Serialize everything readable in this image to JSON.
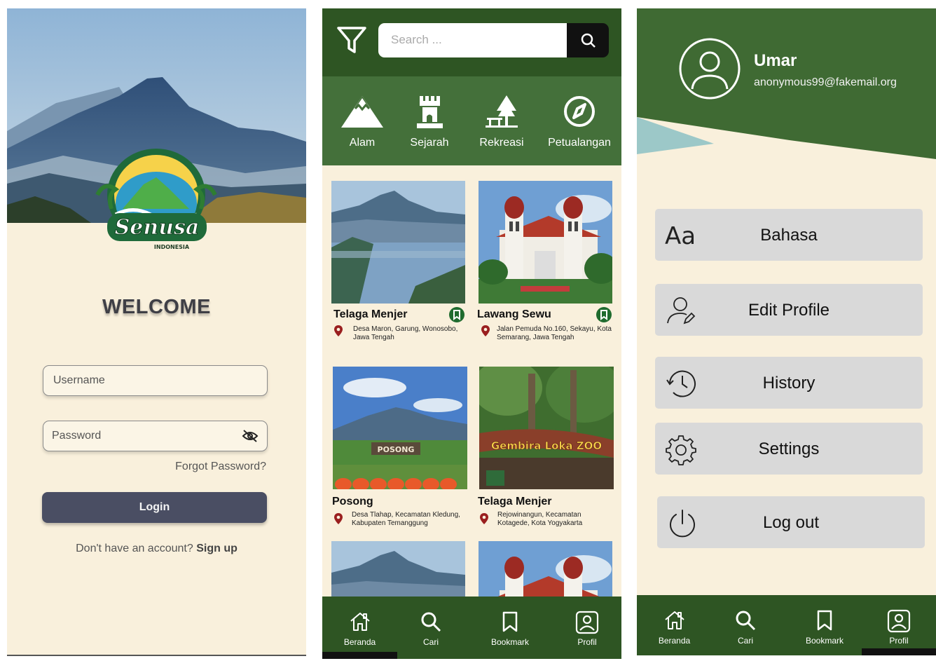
{
  "login": {
    "brand": "Senusa",
    "brand_sub": "INDONESIA",
    "welcome": "WELCOME",
    "username_placeholder": "Username",
    "password_placeholder": "Password",
    "forgot": "Forgot Password?",
    "login_label": "Login",
    "no_account": "Don't have an account?",
    "signup": "Sign up"
  },
  "home": {
    "search_placeholder": "Search ...",
    "categories": [
      {
        "label": "Alam",
        "icon": "mountain-icon"
      },
      {
        "label": "Sejarah",
        "icon": "castle-icon"
      },
      {
        "label": "Rekreasi",
        "icon": "park-icon"
      },
      {
        "label": "Petualangan",
        "icon": "compass-icon"
      }
    ],
    "places": [
      {
        "title": "Telaga Menjer",
        "address": "Desa Maron, Garung, Wonosobo, Jawa Tengah",
        "bookmarked": true
      },
      {
        "title": "Lawang Sewu",
        "address": "Jalan Pemuda No.160, Sekayu, Kota Semarang, Jawa Tengah",
        "bookmarked": true
      },
      {
        "title": "Posong",
        "address": "Desa Tlahap, Kecamatan Kledung, Kabupaten Temanggung",
        "bookmarked": false
      },
      {
        "title": "Telaga Menjer",
        "address": "Rejowinangun, Kecamatan Kotagede, Kota Yogyakarta",
        "bookmarked": false
      }
    ],
    "image_signs": {
      "posong": "POSONG",
      "zoo": "Gembira Loka ZOO"
    },
    "nav": [
      "Beranda",
      "Cari",
      "Bookmark",
      "Profil"
    ],
    "active_nav": "Beranda"
  },
  "profile": {
    "name": "Umar",
    "email": "anonymous99@fakemail.org",
    "menu": [
      {
        "label": "Bahasa",
        "icon": "language-icon"
      },
      {
        "label": "Edit Profile",
        "icon": "edit-profile-icon"
      },
      {
        "label": "History",
        "icon": "history-icon"
      },
      {
        "label": "Settings",
        "icon": "gear-icon"
      },
      {
        "label": "Log out",
        "icon": "power-icon"
      }
    ],
    "nav": [
      "Beranda",
      "Cari",
      "Bookmark",
      "Profil"
    ],
    "active_nav": "Profil"
  },
  "colors": {
    "dark_green": "#2e5523",
    "mid_green": "#44703a",
    "cream": "#f9f0dc",
    "button": "#4a4e63",
    "menu_gray": "#d9d9d9",
    "teal_accent": "#9cc8c8"
  }
}
